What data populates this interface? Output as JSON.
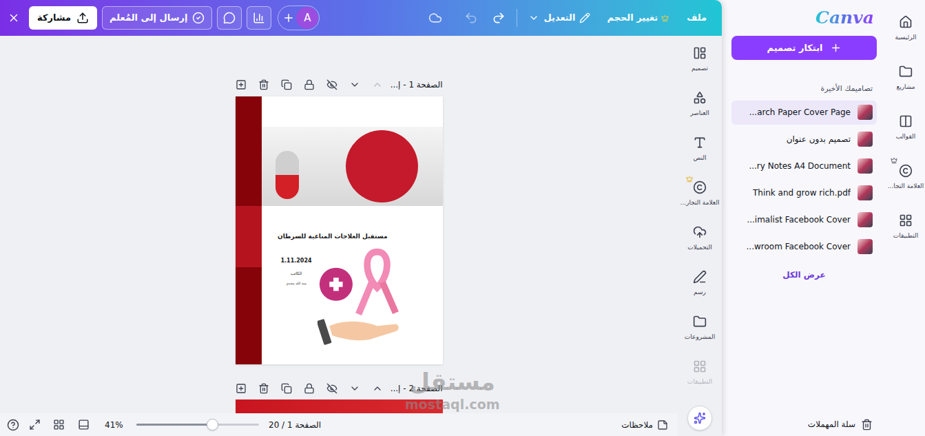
{
  "editor": {
    "topbar": {
      "share": "مشاركة",
      "send_to_teacher": "إرسال إلى المُعلم",
      "avatar": "A",
      "undo_disabled": true,
      "edit": "التعديل",
      "resize": "تغيير الحجم",
      "resize_premium": true,
      "file": "ملف"
    },
    "tools": [
      {
        "label": "تصميم",
        "premium": false,
        "disabled": false
      },
      {
        "label": "العناصر",
        "premium": false,
        "disabled": false
      },
      {
        "label": "النص",
        "premium": false,
        "disabled": false
      },
      {
        "label": "العلامة التجار...",
        "premium": true,
        "disabled": false
      },
      {
        "label": "التحميلات",
        "premium": false,
        "disabled": false
      },
      {
        "label": "رسم",
        "premium": false,
        "disabled": false
      },
      {
        "label": "المشروعات",
        "premium": false,
        "disabled": false
      },
      {
        "label": "التطبيقات",
        "premium": false,
        "disabled": true
      }
    ],
    "pages": [
      {
        "label": "الصفحة 1 - إ...",
        "up_disabled": true
      },
      {
        "label": "الصفحة 2 - إ...",
        "up_disabled": false
      }
    ],
    "document": {
      "title": "مستقبل العلاجات المناعية للسرطان",
      "date": "1.11.2024",
      "author_label": "الكاتب",
      "author": "منة الله مجدي"
    },
    "bottom_bar": {
      "notes": "ملاحظات",
      "page": "الصفحة 1 / 20",
      "zoom": "41%",
      "zoom_level": 0.62
    }
  },
  "home_panel": {
    "logo": "Canva",
    "create_button": "ابتكار تصميم",
    "recent_title": "تصاميمك الأخيرة",
    "recent": [
      {
        "label": "...arch Paper Cover Page",
        "selected": true
      },
      {
        "label": "تصميم بدون عنوان",
        "selected": false
      },
      {
        "label": "...ry Notes A4 Document",
        "selected": false
      },
      {
        "label": "Think and grow rich.pdf",
        "selected": false
      },
      {
        "label": "...imalist Facebook Cover",
        "selected": false
      },
      {
        "label": "...wroom Facebook Cover",
        "selected": false
      }
    ],
    "view_all": "عرض الكل",
    "trash": "سلة المهملات",
    "nav": [
      {
        "label": "الرئيسية",
        "premium": false
      },
      {
        "label": "مشاريع",
        "premium": false
      },
      {
        "label": "القوالب",
        "premium": false
      },
      {
        "label": "العلامة التجا...",
        "premium": true
      },
      {
        "label": "التطبيقات",
        "premium": false
      }
    ]
  },
  "watermark": {
    "arabic": "مستقل",
    "latin": "mostaql.com"
  }
}
